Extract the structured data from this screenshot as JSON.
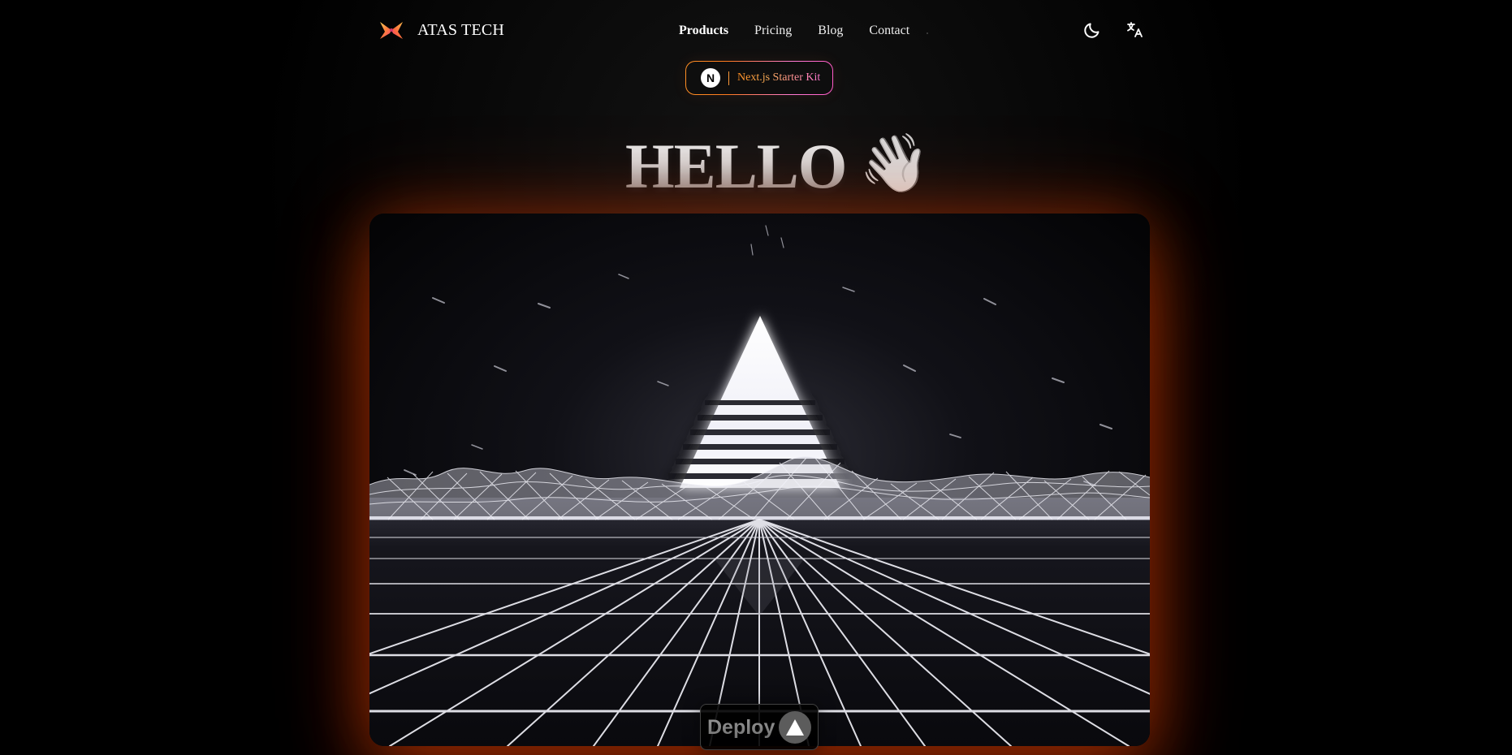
{
  "header": {
    "brand_name": "ATAS TECH",
    "logo": "butterfly-logo",
    "nav": [
      {
        "label": "Products"
      },
      {
        "label": "Pricing"
      },
      {
        "label": "Blog"
      },
      {
        "label": "Contact"
      }
    ],
    "actions": {
      "theme_icon": "moon-icon",
      "language_icon": "translate-icon"
    }
  },
  "announcement": {
    "badge": "N",
    "text": "Next.js Starter Kit",
    "colors": {
      "orange": "#ff8f24",
      "pink": "#ff7bd4"
    }
  },
  "hero": {
    "title": "HELLO",
    "icon": "👋"
  },
  "cta": {
    "deploy_label": "Deploy",
    "deploy_icon": "triangle-icon"
  },
  "colors": {
    "background": "#000000",
    "glow": "#ff4a00",
    "text": "#ffffff"
  }
}
